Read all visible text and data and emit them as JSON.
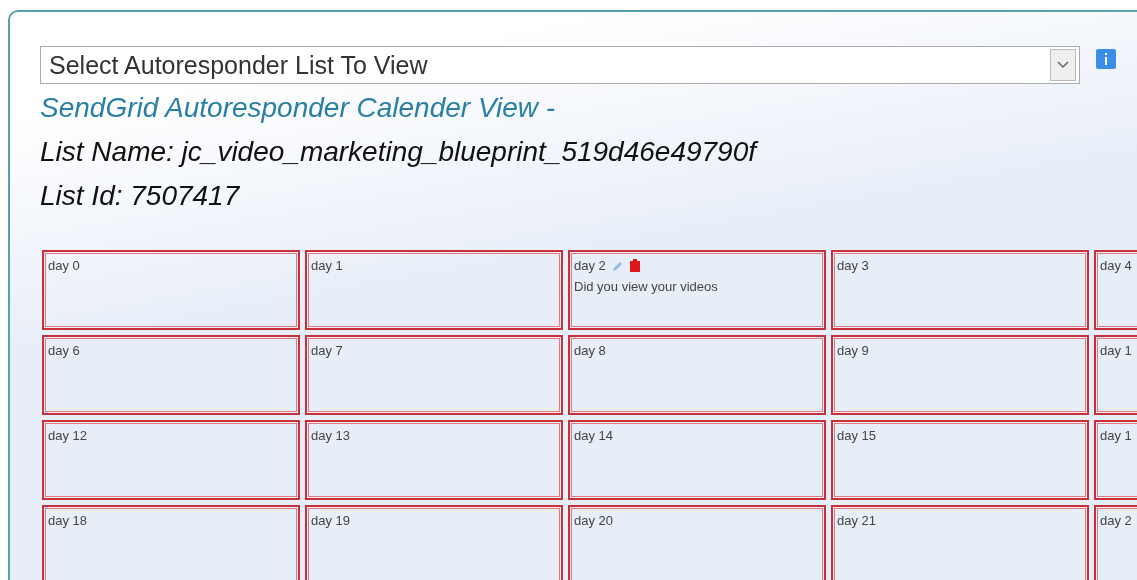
{
  "list_select": {
    "value": "Select Autoresponder List To View"
  },
  "heading": "SendGrid Autoresponder Calender View -",
  "list_name": "List Name: jc_video_marketing_blueprint_519d46e49790f",
  "list_id": "List Id: 7507417",
  "calendar": [
    [
      {
        "day": "day 0"
      },
      {
        "day": "day 1"
      },
      {
        "day": "day 2",
        "message": "Did you view your videos",
        "has_actions": true
      },
      {
        "day": "day 3"
      },
      {
        "day": "day 4"
      }
    ],
    [
      {
        "day": "day 6"
      },
      {
        "day": "day 7"
      },
      {
        "day": "day 8"
      },
      {
        "day": "day 9"
      },
      {
        "day": "day 1"
      }
    ],
    [
      {
        "day": "day 12"
      },
      {
        "day": "day 13"
      },
      {
        "day": "day 14"
      },
      {
        "day": "day 15"
      },
      {
        "day": "day 1"
      }
    ],
    [
      {
        "day": "day 18"
      },
      {
        "day": "day 19"
      },
      {
        "day": "day 20"
      },
      {
        "day": "day 21"
      },
      {
        "day": "day 2"
      }
    ]
  ]
}
